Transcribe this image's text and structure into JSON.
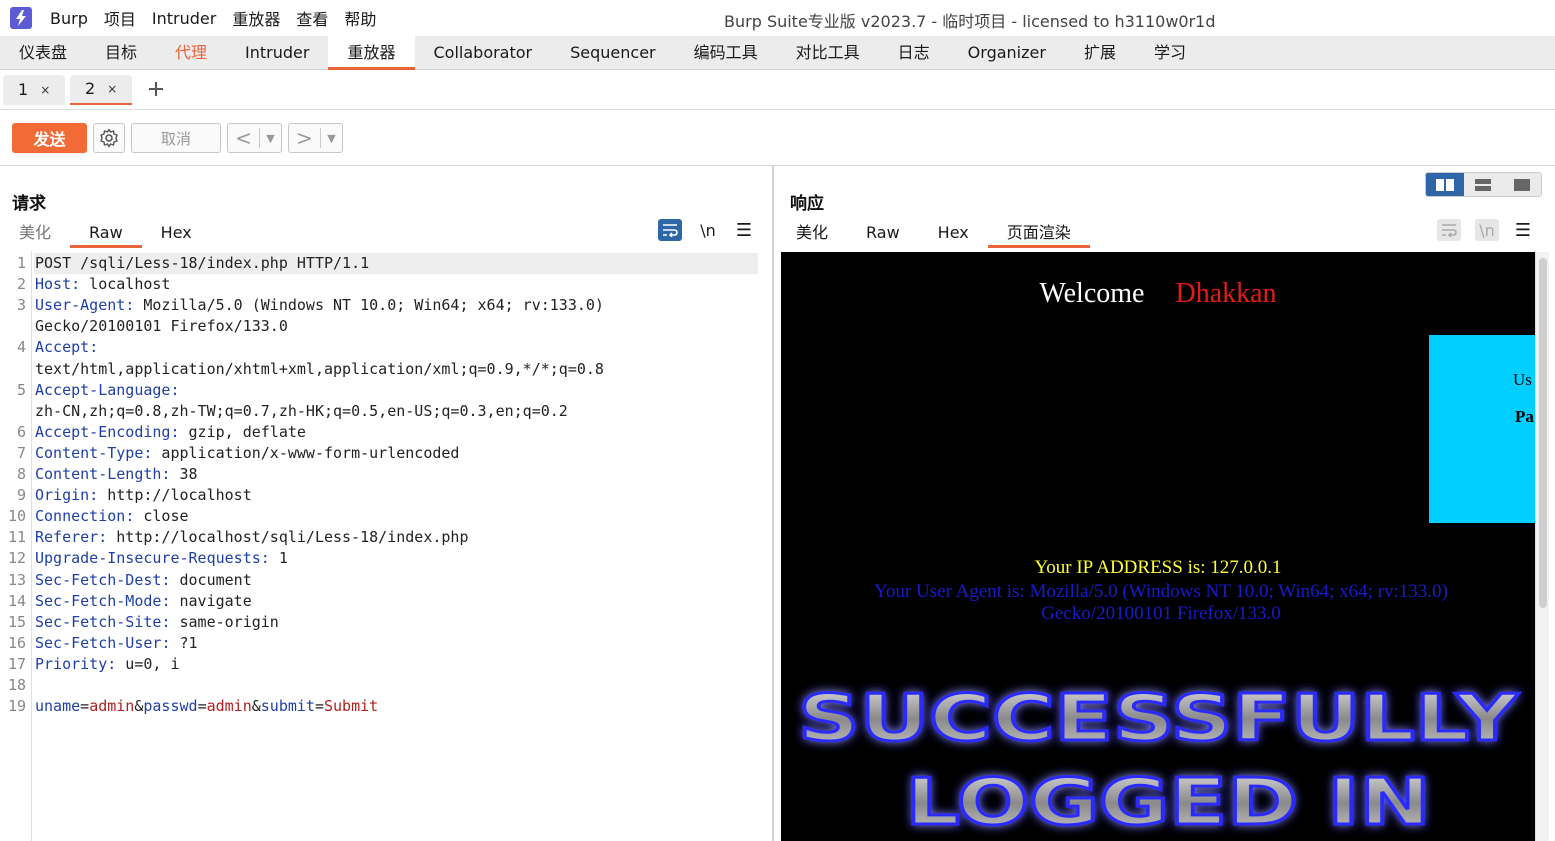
{
  "app": {
    "menu": [
      "Burp",
      "项目",
      "Intruder",
      "重放器",
      "查看",
      "帮助"
    ],
    "window_title": "Burp Suite专业版  v2023.7 - 临时项目 - licensed to h3110w0r1d"
  },
  "main_tabs": [
    "仪表盘",
    "目标",
    "代理",
    "Intruder",
    "重放器",
    "Collaborator",
    "Sequencer",
    "编码工具",
    "对比工具",
    "日志",
    "Organizer",
    "扩展",
    "学习"
  ],
  "request_tabs": [
    {
      "label": "1",
      "close": "×"
    },
    {
      "label": "2",
      "close": "×"
    }
  ],
  "toolbar": {
    "send_label": "发送",
    "cancel_label": "取消"
  },
  "request_pane": {
    "title": "请求",
    "view_tabs": [
      "美化",
      "Raw",
      "Hex"
    ],
    "newline_label": "\\n",
    "lines": [
      {
        "n": "1",
        "text": "POST /sqli/Less-18/index.php HTTP/1.1"
      },
      {
        "n": "2",
        "name": "Host",
        "value": " localhost"
      },
      {
        "n": "3",
        "name": "User-Agent",
        "value": " Mozilla/5.0 (Windows NT 10.0; Win64; x64; rv:133.0)"
      },
      {
        "n": "",
        "text": "Gecko/20100101 Firefox/133.0"
      },
      {
        "n": "4",
        "name": "Accept",
        "value": ""
      },
      {
        "n": "",
        "text": "text/html,application/xhtml+xml,application/xml;q=0.9,*/*;q=0.8"
      },
      {
        "n": "5",
        "name": "Accept-Language",
        "value": ""
      },
      {
        "n": "",
        "text": "zh-CN,zh;q=0.8,zh-TW;q=0.7,zh-HK;q=0.5,en-US;q=0.3,en;q=0.2"
      },
      {
        "n": "6",
        "name": "Accept-Encoding",
        "value": " gzip, deflate"
      },
      {
        "n": "7",
        "name": "Content-Type",
        "value": " application/x-www-form-urlencoded"
      },
      {
        "n": "8",
        "name": "Content-Length",
        "value": " 38"
      },
      {
        "n": "9",
        "name": "Origin",
        "value": " http://localhost"
      },
      {
        "n": "10",
        "name": "Connection",
        "value": " close"
      },
      {
        "n": "11",
        "name": "Referer",
        "value": " http://localhost/sqli/Less-18/index.php"
      },
      {
        "n": "12",
        "name": "Upgrade-Insecure-Requests",
        "value": " 1"
      },
      {
        "n": "13",
        "name": "Sec-Fetch-Dest",
        "value": " document"
      },
      {
        "n": "14",
        "name": "Sec-Fetch-Mode",
        "value": " navigate"
      },
      {
        "n": "15",
        "name": "Sec-Fetch-Site",
        "value": " same-origin"
      },
      {
        "n": "16",
        "name": "Sec-Fetch-User",
        "value": " ?1"
      },
      {
        "n": "17",
        "name": "Priority",
        "value": " u=0, i"
      },
      {
        "n": "18",
        "text": ""
      },
      {
        "n": "19",
        "params": [
          [
            "uname",
            "admin"
          ],
          [
            "passwd",
            "admin"
          ],
          [
            "submit",
            "Submit"
          ]
        ]
      }
    ]
  },
  "response_pane": {
    "title": "响应",
    "view_tabs": [
      "美化",
      "Raw",
      "Hex",
      "页面渲染"
    ],
    "newline_label": "\\n",
    "render": {
      "welcome": "Welcome",
      "name": "Dhakkan",
      "box_user_label": "Us",
      "box_pass_label": "Pa",
      "ip_text": "Your IP ADDRESS is: 127.0.0.1",
      "ua_text": "Your User Agent is: Mozilla/5.0 (Windows NT 10.0; Win64; x64; rv:133.0) Gecko/20100101 Firefox/133.0",
      "banner_line1": "SUCCESSFULLY",
      "banner_line2": "LOGGED IN"
    }
  },
  "colors": {
    "accent": "#e8643c",
    "send": "#f26a35",
    "header_name": "#1f3fa8",
    "param_value": "#b0201e",
    "layout_active": "#2f66a8"
  }
}
